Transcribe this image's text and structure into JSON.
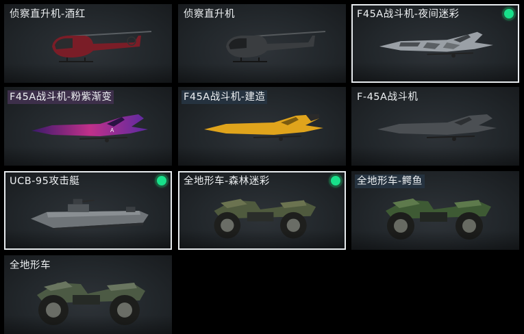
{
  "vehicles": [
    {
      "label": "侦察直升机-酒红",
      "kind": "helicopter",
      "color": "#7a1d27",
      "selected": false,
      "equipped": false
    },
    {
      "label": "侦察直升机",
      "kind": "helicopter",
      "color": "#3a3d40",
      "selected": false,
      "equipped": false
    },
    {
      "label": "F45A战斗机-夜间迷彩",
      "kind": "jet",
      "color": "#9aa0a6",
      "selected": true,
      "equipped": true
    },
    {
      "label": "F45A战斗机-粉紫渐变",
      "kind": "jet",
      "color": "#c0308a",
      "selected": false,
      "equipped": false
    },
    {
      "label": "F45A战斗机-建造",
      "kind": "jet",
      "color": "#e0a41c",
      "selected": false,
      "equipped": false
    },
    {
      "label": "F-45A战斗机",
      "kind": "jet",
      "color": "#4b4f53",
      "selected": false,
      "equipped": false
    },
    {
      "label": "UCB-95攻击艇",
      "kind": "boat",
      "color": "#6f7478",
      "selected": true,
      "equipped": true
    },
    {
      "label": "全地形车-森林迷彩",
      "kind": "atv",
      "color": "#4f5a3e",
      "selected": true,
      "equipped": true
    },
    {
      "label": "全地形车-鳄鱼",
      "kind": "atv",
      "color": "#3e5a34",
      "selected": false,
      "equipped": false
    },
    {
      "label": "全地形车",
      "kind": "atv",
      "color": "#4c5a44",
      "selected": false,
      "equipped": false
    }
  ],
  "colors": {
    "equipped_dot": "#18e08a",
    "selected_border": "#e8ecef"
  }
}
